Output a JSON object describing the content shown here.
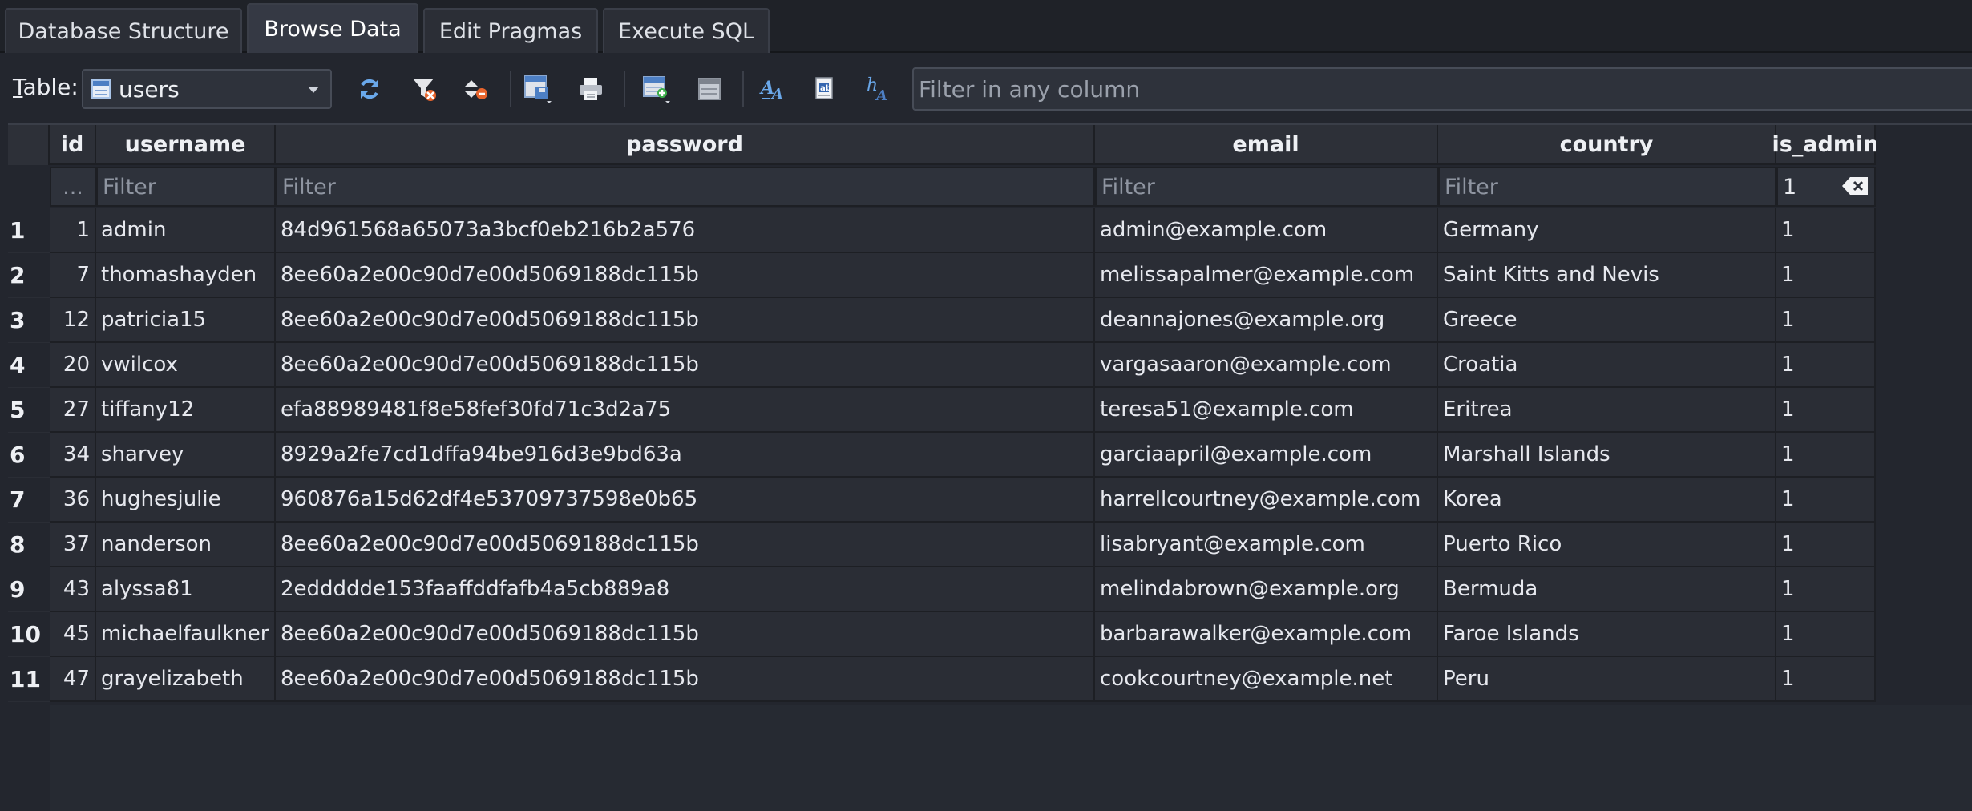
{
  "tabs": [
    {
      "label": "Database Structure"
    },
    {
      "label": "Browse Data"
    },
    {
      "label": "Edit Pragmas"
    },
    {
      "label": "Execute SQL"
    }
  ],
  "active_tab": "Browse Data",
  "toolbar": {
    "table_label_prefix": "T",
    "table_label_rest": "able:",
    "selected_table": "users",
    "filter_placeholder": "Filter in any column",
    "buttons": [
      {
        "icon": "refresh-icon"
      },
      {
        "icon": "clear-filters-icon"
      },
      {
        "icon": "clear-sort-icon"
      },
      {
        "icon": "save-table-icon"
      },
      {
        "icon": "print-icon"
      },
      {
        "icon": "insert-record-icon"
      },
      {
        "icon": "delete-record-icon"
      },
      {
        "icon": "find-icon"
      },
      {
        "icon": "find-replace-icon"
      },
      {
        "icon": "text-format-icon"
      }
    ]
  },
  "grid": {
    "columns": [
      "id",
      "username",
      "password",
      "email",
      "country",
      "is_admin"
    ],
    "filters": {
      "id": "...",
      "username_placeholder": "Filter",
      "password_placeholder": "Filter",
      "email_placeholder": "Filter",
      "country_placeholder": "Filter",
      "is_admin_value": "1"
    },
    "rows": [
      {
        "n": "1",
        "id": "1",
        "username": "admin",
        "password": "84d961568a65073a3bcf0eb216b2a576",
        "email": "admin@example.com",
        "country": "Germany",
        "is_admin": "1"
      },
      {
        "n": "2",
        "id": "7",
        "username": "thomashayden",
        "password": "8ee60a2e00c90d7e00d5069188dc115b",
        "email": "melissapalmer@example.com",
        "country": "Saint Kitts and Nevis",
        "is_admin": "1"
      },
      {
        "n": "3",
        "id": "12",
        "username": "patricia15",
        "password": "8ee60a2e00c90d7e00d5069188dc115b",
        "email": "deannajones@example.org",
        "country": "Greece",
        "is_admin": "1"
      },
      {
        "n": "4",
        "id": "20",
        "username": "vwilcox",
        "password": "8ee60a2e00c90d7e00d5069188dc115b",
        "email": "vargasaaron@example.com",
        "country": "Croatia",
        "is_admin": "1"
      },
      {
        "n": "5",
        "id": "27",
        "username": "tiffany12",
        "password": "efa88989481f8e58fef30fd71c3d2a75",
        "email": "teresa51@example.com",
        "country": "Eritrea",
        "is_admin": "1"
      },
      {
        "n": "6",
        "id": "34",
        "username": "sharvey",
        "password": "8929a2fe7cd1dffa94be916d3e9bd63a",
        "email": "garciaapril@example.com",
        "country": "Marshall Islands",
        "is_admin": "1"
      },
      {
        "n": "7",
        "id": "36",
        "username": "hughesjulie",
        "password": "960876a15d62df4e53709737598e0b65",
        "email": "harrellcourtney@example.com",
        "country": "Korea",
        "is_admin": "1"
      },
      {
        "n": "8",
        "id": "37",
        "username": "nanderson",
        "password": "8ee60a2e00c90d7e00d5069188dc115b",
        "email": "lisabryant@example.com",
        "country": "Puerto Rico",
        "is_admin": "1"
      },
      {
        "n": "9",
        "id": "43",
        "username": "alyssa81",
        "password": "2eddddde153faaffddfafb4a5cb889a8",
        "email": "melindabrown@example.org",
        "country": "Bermuda",
        "is_admin": "1"
      },
      {
        "n": "10",
        "id": "45",
        "username": "michaelfaulkner",
        "password": "8ee60a2e00c90d7e00d5069188dc115b",
        "email": "barbarawalker@example.com",
        "country": "Faroe Islands",
        "is_admin": "1"
      },
      {
        "n": "11",
        "id": "47",
        "username": "grayelizabeth",
        "password": "8ee60a2e00c90d7e00d5069188dc115b",
        "email": "cookcourtney@example.net",
        "country": "Peru",
        "is_admin": "1"
      }
    ]
  },
  "colors": {
    "background": "#23262e",
    "header": "#2d3038",
    "cell": "#2a2d35",
    "accent_blue": "#4d7fc4"
  }
}
